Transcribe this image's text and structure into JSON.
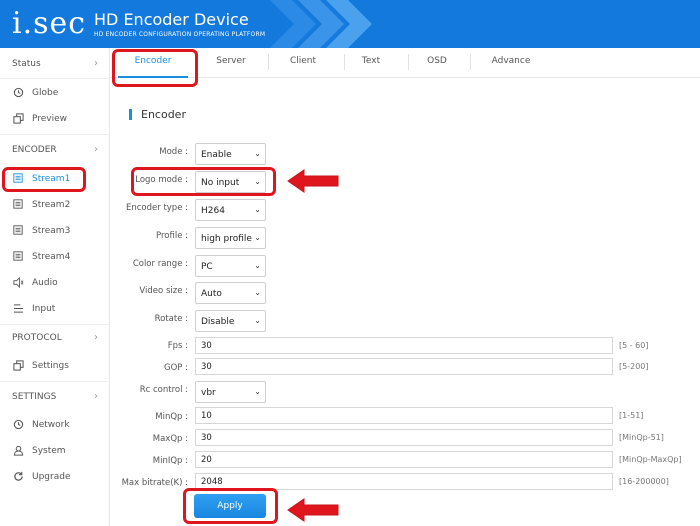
{
  "header": {
    "logo": "i.sec",
    "title": "HD Encoder Device",
    "subtitle": "HD ENCODER CONFIGURATION OPERATING PLATFORM"
  },
  "sidebar": {
    "status_label": "Status",
    "items_status": [
      {
        "label": "Globe",
        "icon": "clock-icon"
      },
      {
        "label": "Preview",
        "icon": "preview-icon"
      }
    ],
    "encoder_label": "ENCODER",
    "items_encoder": [
      {
        "label": "Stream1",
        "icon": "list-icon"
      },
      {
        "label": "Stream2",
        "icon": "list-icon"
      },
      {
        "label": "Stream3",
        "icon": "list-icon"
      },
      {
        "label": "Stream4",
        "icon": "list-icon"
      },
      {
        "label": "Audio",
        "icon": "speaker-icon"
      },
      {
        "label": "Input",
        "icon": "input-icon"
      }
    ],
    "protocol_label": "PROTOCOL",
    "items_protocol": [
      {
        "label": "Settings",
        "icon": "settings-icon"
      }
    ],
    "settings_label": "SETTINGS",
    "items_settings": [
      {
        "label": "Network",
        "icon": "clock-icon"
      },
      {
        "label": "System",
        "icon": "user-icon"
      },
      {
        "label": "Upgrade",
        "icon": "refresh-icon"
      }
    ]
  },
  "tabs": [
    "Encoder",
    "Server",
    "Client",
    "Text",
    "OSD",
    "Advance"
  ],
  "section_title": "Encoder",
  "form": {
    "mode": {
      "label": "Mode :",
      "value": "Enable"
    },
    "logo_mode": {
      "label": "Logo mode :",
      "value": "No input"
    },
    "encoder_type": {
      "label": "Encoder type :",
      "value": "H264"
    },
    "profile": {
      "label": "Profile :",
      "value": "high profile"
    },
    "color_range": {
      "label": "Color range :",
      "value": "PC"
    },
    "video_size": {
      "label": "Video size :",
      "value": "Auto"
    },
    "rotate": {
      "label": "Rotate :",
      "value": "Disable"
    },
    "fps": {
      "label": "Fps :",
      "value": "30",
      "range": "[5 - 60]"
    },
    "gop": {
      "label": "GOP :",
      "value": "30",
      "range": "[5-200]"
    },
    "rc_control": {
      "label": "Rc control :",
      "value": "vbr"
    },
    "minqp": {
      "label": "MinQp :",
      "value": "10",
      "range": "[1-51]"
    },
    "maxqp": {
      "label": "MaxQp :",
      "value": "30",
      "range": "[MinQp-51]"
    },
    "miniqp": {
      "label": "MinIQp :",
      "value": "20",
      "range": "[MinQp-MaxQp]"
    },
    "max_bitrate": {
      "label": "Max bitrate(K) :",
      "value": "2048",
      "range": "[16-200000]"
    }
  },
  "apply_label": "Apply",
  "colors": {
    "header": "#1479dd",
    "accent": "#1a8fe0",
    "annotation": "#e0161e"
  }
}
